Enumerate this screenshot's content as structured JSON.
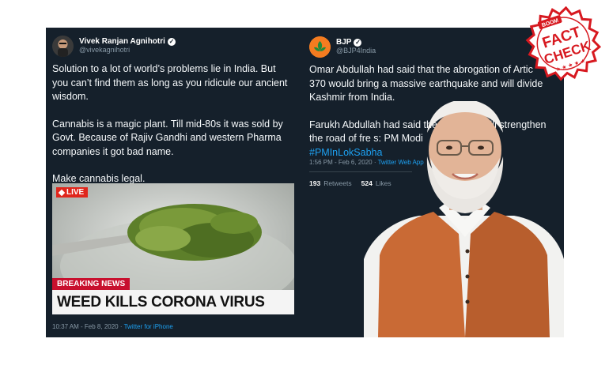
{
  "left_tweet": {
    "display_name": "Vivek Ranjan Agnihotri",
    "handle": "@vivekagnihotri",
    "paragraphs": [
      "Solution to a lot of world’s problems lie in India. But you can’t find them as long as you ridicule our ancient wisdom.",
      "Cannabis is a magic plant. Till mid-80s it was sold by Govt.  Because of Rajiv Gandhi and western Pharma companies it got bad name.",
      "Make cannabis legal."
    ],
    "media": {
      "live_label": "LIVE",
      "breaking_label": "BREAKING NEWS",
      "headline": "WEED KILLS CORONA VIRUS"
    },
    "timestamp": "10:37 AM - Feb 8, 2020",
    "client": "Twitter for iPhone"
  },
  "right_tweet": {
    "display_name": "BJP",
    "handle": "@BJP4India",
    "paragraphs": [
      "Omar Abdullah had said that the abrogation of Artic 370 would bring a massive earthquake and will divide Kashmir from India.",
      "Farukh Abdullah had said the rticle 370 will strengthen the road of fre s: PM Modi"
    ],
    "hashtag": "#PMInLokSabha",
    "timestamp": "1:56 PM - Feb 6, 2020",
    "client": "Twitter Web App",
    "retweets_count": "193",
    "retweets_label": "Retweets",
    "likes_count": "524",
    "likes_label": "Likes"
  },
  "stamp": {
    "brand": "BOOM",
    "line1": "FACT",
    "line2": "CHECK"
  },
  "colors": {
    "tweet_bg": "#15202b",
    "link_blue": "#1da1f2",
    "live_red": "#e0261c",
    "stamp_red": "#d71920",
    "bjp_orange": "#f47c20"
  }
}
